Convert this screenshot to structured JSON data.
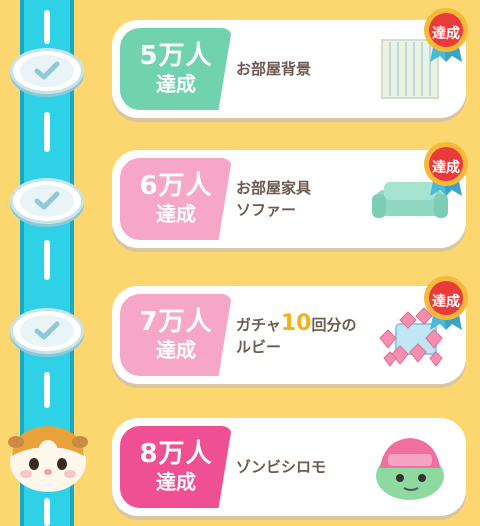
{
  "milestones": [
    {
      "number_label": "5万人",
      "achieved_label": "達成",
      "reward_line1": "お部屋背景",
      "reward_line2": "",
      "badge_color": "#71d3ae",
      "completed": true,
      "medal_label": "達成"
    },
    {
      "number_label": "6万人",
      "achieved_label": "達成",
      "reward_line1": "お部屋家具",
      "reward_line2": "ソファー",
      "badge_color": "#f6a6c6",
      "completed": true,
      "medal_label": "達成"
    },
    {
      "number_label": "7万人",
      "achieved_label": "達成",
      "reward_line1_pre": "ガチャ",
      "reward_line1_num": "10",
      "reward_line1_post": "回分の",
      "reward_line2": "ルビー",
      "badge_color": "#f6a6c6",
      "completed": true,
      "medal_label": "達成"
    },
    {
      "number_label": "8万人",
      "achieved_label": "達成",
      "reward_line1": "ゾンビシロモ",
      "reward_line2": "",
      "badge_color": "#ef4f93",
      "completed": false
    }
  ],
  "icons": {
    "check": "check-icon",
    "medal": "achievement-medal-icon",
    "mascot": "guinea-pig-mascot-icon"
  }
}
